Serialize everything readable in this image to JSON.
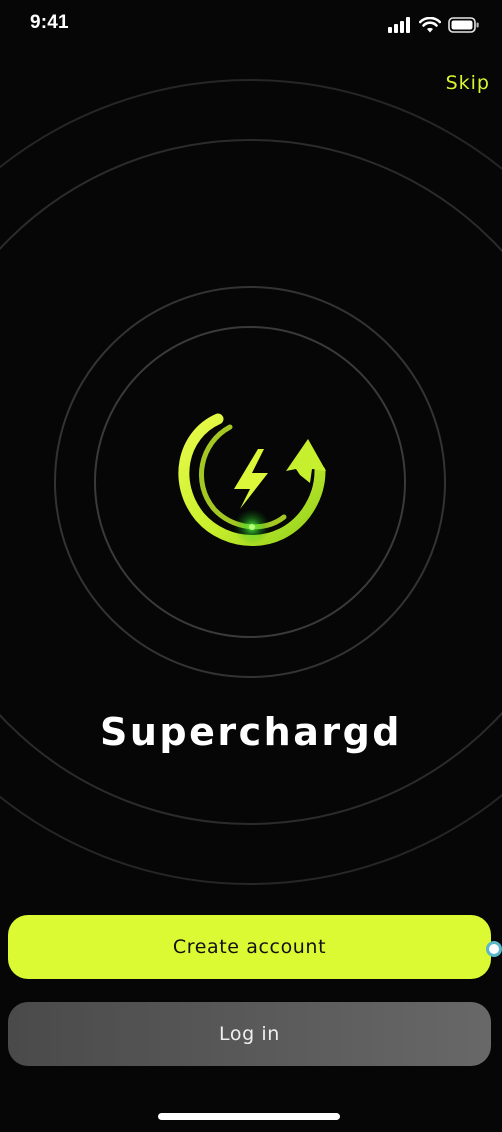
{
  "status_bar": {
    "time": "9:41",
    "icons": [
      "cellular-signal-icon",
      "wifi-icon",
      "battery-icon"
    ]
  },
  "header": {
    "skip_label": "Skip"
  },
  "brand": {
    "app_name": "Superchargd",
    "logo_icon": "lightning-bolt-circular-arrow-icon",
    "accent_color": "#dbfa33"
  },
  "actions": {
    "create_account_label": "Create account",
    "login_label": "Log in"
  },
  "colors": {
    "background": "#050605",
    "primary_button": "#dbfa33",
    "secondary_button": "#5a5a5a",
    "skip_text": "#d8f533"
  }
}
